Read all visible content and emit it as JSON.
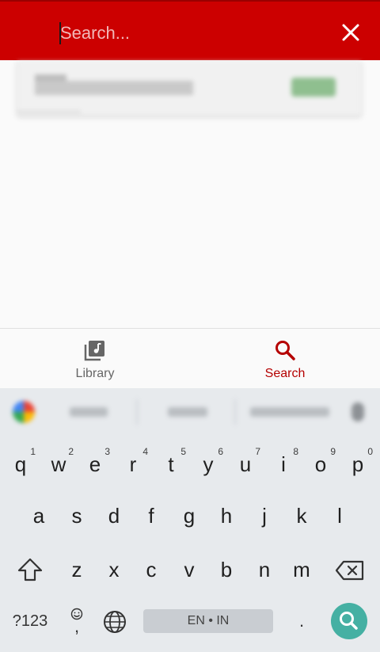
{
  "search": {
    "placeholder": "Search..."
  },
  "nav": {
    "library_label": "Library",
    "search_label": "Search"
  },
  "keyboard": {
    "row1": [
      {
        "key": "q",
        "hint": "1"
      },
      {
        "key": "w",
        "hint": "2"
      },
      {
        "key": "e",
        "hint": "3"
      },
      {
        "key": "r",
        "hint": "4"
      },
      {
        "key": "t",
        "hint": "5"
      },
      {
        "key": "y",
        "hint": "6"
      },
      {
        "key": "u",
        "hint": "7"
      },
      {
        "key": "i",
        "hint": "8"
      },
      {
        "key": "o",
        "hint": "9"
      },
      {
        "key": "p",
        "hint": "0"
      }
    ],
    "row2": [
      "a",
      "s",
      "d",
      "f",
      "g",
      "h",
      "j",
      "k",
      "l"
    ],
    "row3": [
      "z",
      "x",
      "c",
      "v",
      "b",
      "n",
      "m"
    ],
    "symbols_label": "?123",
    "comma": ",",
    "space_label": "EN • IN",
    "period": "."
  },
  "colors": {
    "toolbar": "#cc0000",
    "active_tab": "#b50000",
    "enter_key": "#45b0a3"
  }
}
